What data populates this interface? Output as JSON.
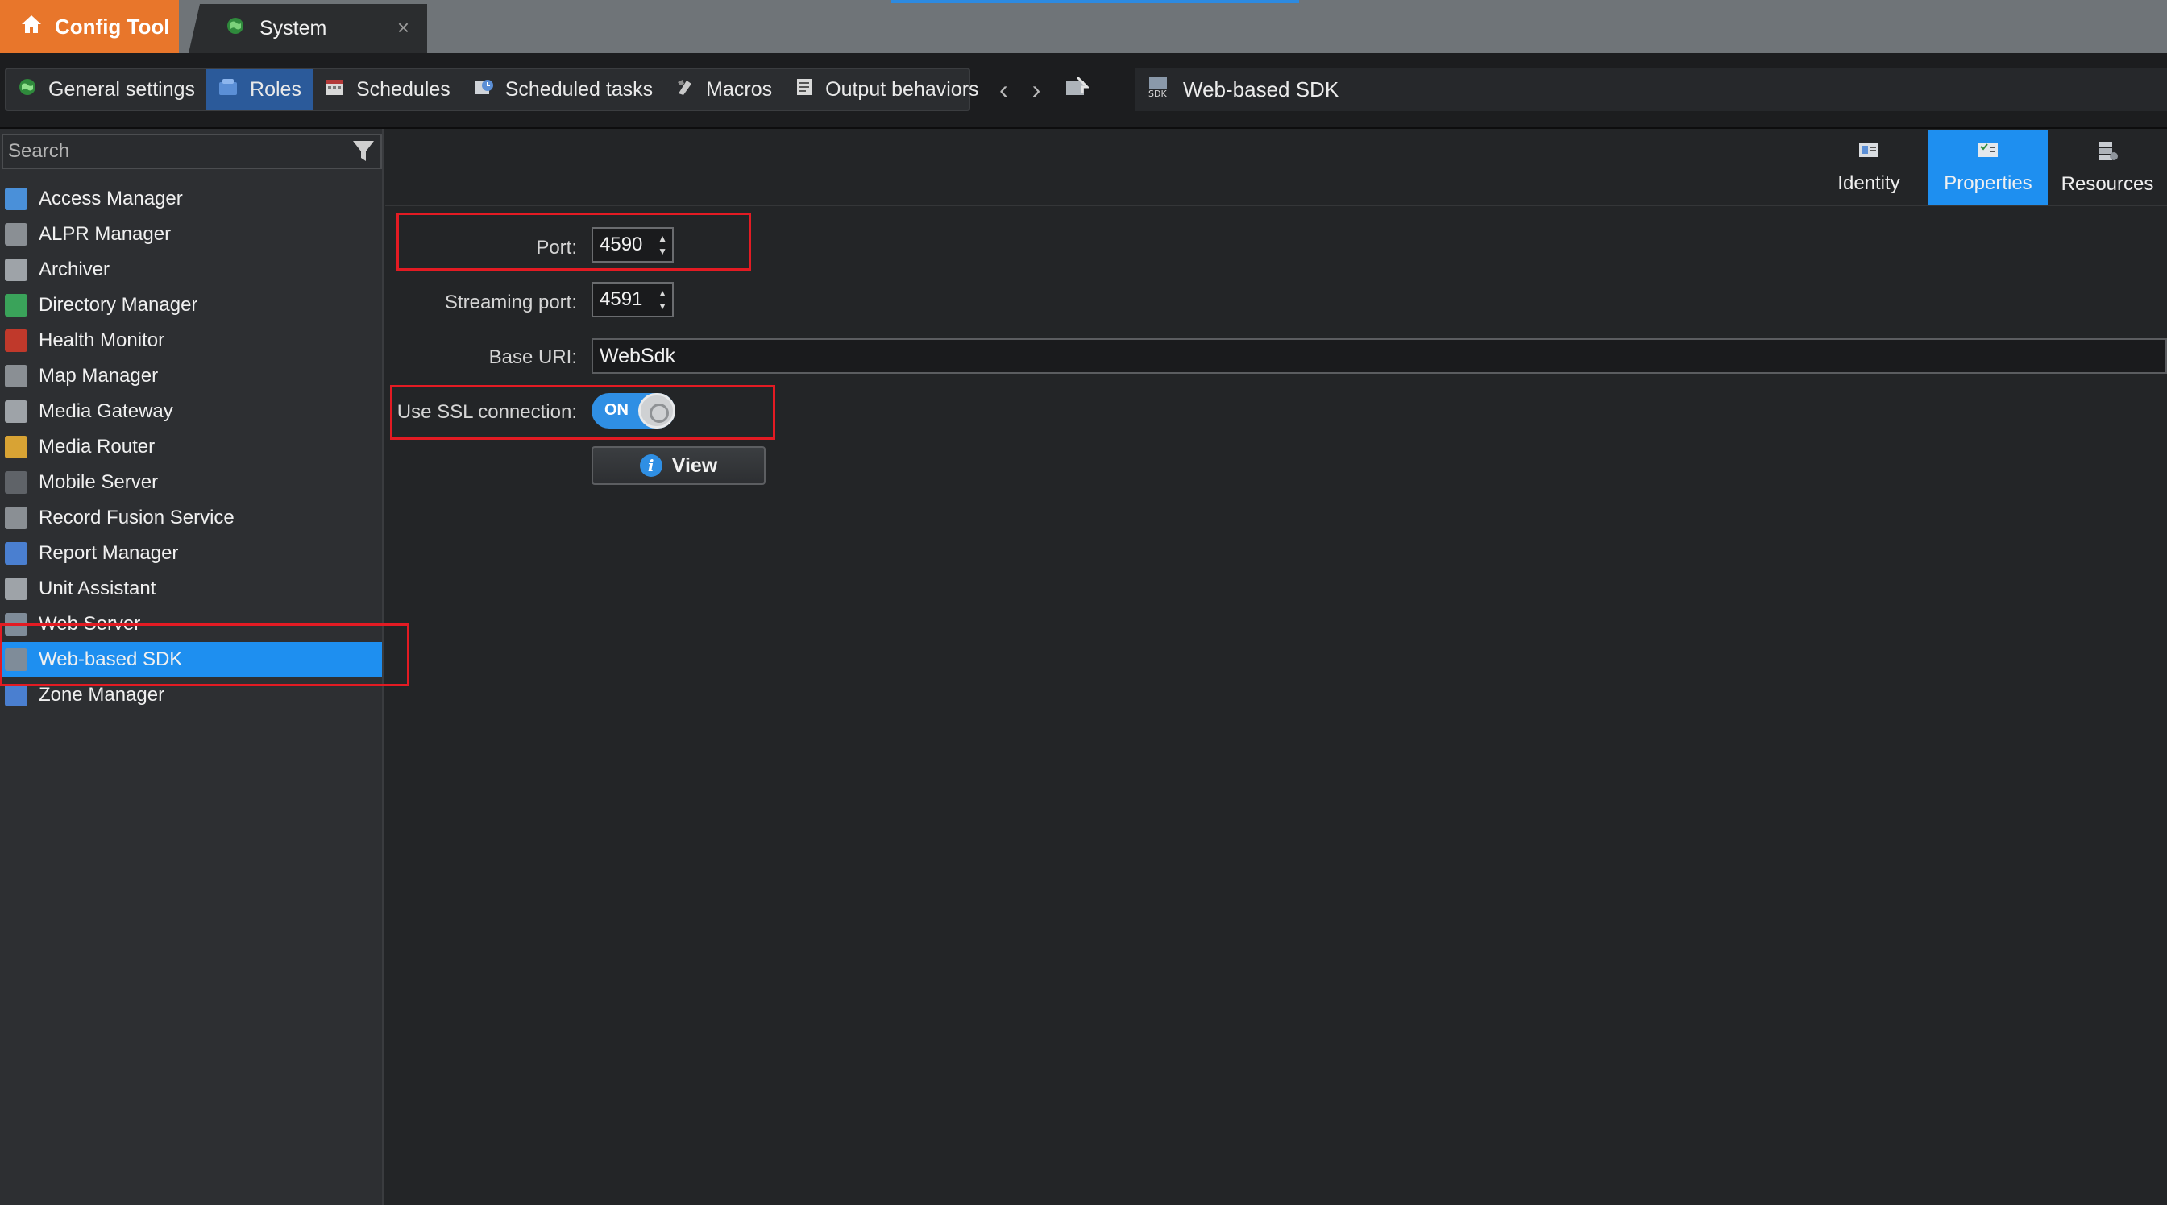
{
  "tabs": {
    "app_tab": "Config Tool",
    "system_tab": "System",
    "close_glyph": "×"
  },
  "toolbar": {
    "tasks": [
      {
        "label": "General settings",
        "icon": "globe-icon",
        "active": false
      },
      {
        "label": "Roles",
        "icon": "roles-icon",
        "active": true
      },
      {
        "label": "Schedules",
        "icon": "calendar-icon",
        "active": false
      },
      {
        "label": "Scheduled tasks",
        "icon": "clock-task-icon",
        "active": false
      },
      {
        "label": "Macros",
        "icon": "macro-icon",
        "active": false
      },
      {
        "label": "Output behaviors",
        "icon": "output-icon",
        "active": false
      }
    ],
    "breadcrumb": "Web-based SDK"
  },
  "sidebar": {
    "search_placeholder": "Search",
    "items": [
      {
        "label": "Access Manager",
        "icon": "access-manager-icon",
        "color": "#4a90d9"
      },
      {
        "label": "ALPR Manager",
        "icon": "alpr-icon",
        "color": "#8a8f94"
      },
      {
        "label": "Archiver",
        "icon": "archiver-icon",
        "color": "#9ea3a8"
      },
      {
        "label": "Directory Manager",
        "icon": "directory-icon",
        "color": "#3aa35a"
      },
      {
        "label": "Health Monitor",
        "icon": "health-icon",
        "color": "#c0392b"
      },
      {
        "label": "Map Manager",
        "icon": "map-icon",
        "color": "#8a8f94"
      },
      {
        "label": "Media Gateway",
        "icon": "gateway-icon",
        "color": "#9ea3a8"
      },
      {
        "label": "Media Router",
        "icon": "router-icon",
        "color": "#d8a334"
      },
      {
        "label": "Mobile Server",
        "icon": "mobile-icon",
        "color": "#5f6368"
      },
      {
        "label": "Record Fusion Service",
        "icon": "fusion-icon",
        "color": "#8a8f94"
      },
      {
        "label": "Report Manager",
        "icon": "report-icon",
        "color": "#4a7fd0"
      },
      {
        "label": "Unit Assistant",
        "icon": "assistant-icon",
        "color": "#9ea3a8"
      },
      {
        "label": "Web Server",
        "icon": "web-server-icon",
        "color": "#7f8c99"
      },
      {
        "label": "Web-based SDK",
        "icon": "sdk-icon",
        "color": "#7f8c99",
        "selected": true
      },
      {
        "label": "Zone Manager",
        "icon": "zone-icon",
        "color": "#4a7fd0"
      }
    ]
  },
  "page_tabs": [
    {
      "label": "Identity",
      "icon": "identity-icon",
      "active": false
    },
    {
      "label": "Properties",
      "icon": "properties-icon",
      "active": true
    },
    {
      "label": "Resources",
      "icon": "resources-icon",
      "active": false
    }
  ],
  "form": {
    "port_label": "Port:",
    "port_value": "4590",
    "streaming_label": "Streaming port:",
    "streaming_value": "4591",
    "base_uri_label": "Base URI:",
    "base_uri_value": "WebSdk",
    "ssl_label": "Use SSL connection:",
    "ssl_state": "ON",
    "view_button": "View",
    "info_glyph": "i"
  },
  "colors": {
    "accent": "#1e8ff0",
    "config_tab": "#e8762b",
    "highlight": "#e31b23"
  }
}
